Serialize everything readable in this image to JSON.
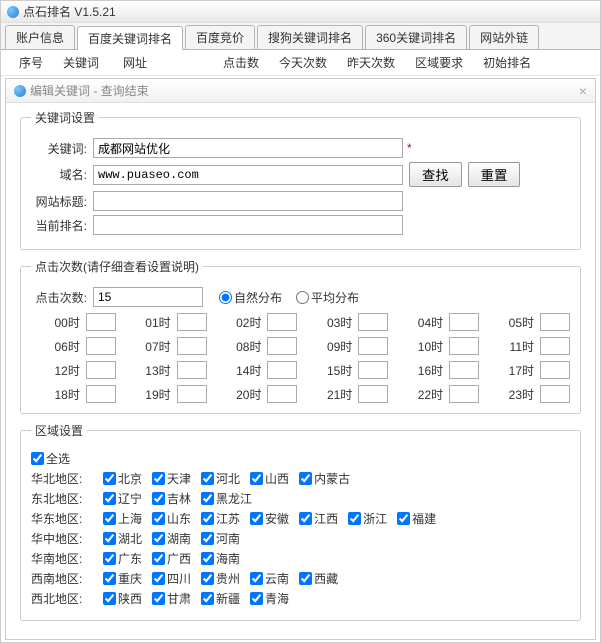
{
  "window": {
    "title": "点石排名 V1.5.21"
  },
  "tabs": [
    {
      "label": "账户信息",
      "active": false
    },
    {
      "label": "百度关键词排名",
      "active": true
    },
    {
      "label": "百度竞价",
      "active": false
    },
    {
      "label": "搜狗关键词排名",
      "active": false
    },
    {
      "label": "360关键词排名",
      "active": false
    },
    {
      "label": "网站外链",
      "active": false
    }
  ],
  "columns": [
    "序号",
    "关键词",
    "网址",
    "点击数",
    "今天次数",
    "昨天次数",
    "区域要求",
    "初始排名"
  ],
  "dialog": {
    "title": "编辑关键词 - 查询结束",
    "kw_group": "关键词设置",
    "kw": {
      "label": "关键词:",
      "value": "成都网站优化"
    },
    "domain": {
      "label": "域名:",
      "value": "www.puaseo.com"
    },
    "sitetitle": {
      "label": "网站标题:",
      "value": ""
    },
    "rank": {
      "label": "当前排名:",
      "value": ""
    },
    "btn_find": "查找",
    "btn_reset": "重置",
    "click_group": "点击次数(请仔细查看设置说明)",
    "click_label": "点击次数:",
    "click_value": "15",
    "radio_natural": "自然分布",
    "radio_avg": "平均分布",
    "hours": [
      "00时",
      "01时",
      "02时",
      "03时",
      "04时",
      "05时",
      "06时",
      "07时",
      "08时",
      "09时",
      "10时",
      "11时",
      "12时",
      "13时",
      "14时",
      "15时",
      "16时",
      "17时",
      "18时",
      "19时",
      "20时",
      "21时",
      "22时",
      "23时"
    ],
    "region_group": "区域设置",
    "select_all": "全选",
    "regions": [
      {
        "name": "华北地区:",
        "items": [
          "北京",
          "天津",
          "河北",
          "山西",
          "内蒙古"
        ]
      },
      {
        "name": "东北地区:",
        "items": [
          "辽宁",
          "吉林",
          "黑龙江"
        ]
      },
      {
        "name": "华东地区:",
        "items": [
          "上海",
          "山东",
          "江苏",
          "安徽",
          "江西",
          "浙江",
          "福建"
        ]
      },
      {
        "name": "华中地区:",
        "items": [
          "湖北",
          "湖南",
          "河南"
        ]
      },
      {
        "name": "华南地区:",
        "items": [
          "广东",
          "广西",
          "海南"
        ]
      },
      {
        "name": "西南地区:",
        "items": [
          "重庆",
          "四川",
          "贵州",
          "云南",
          "西藏"
        ]
      },
      {
        "name": "西北地区:",
        "items": [
          "陕西",
          "甘肃",
          "新疆",
          "青海"
        ]
      }
    ]
  }
}
